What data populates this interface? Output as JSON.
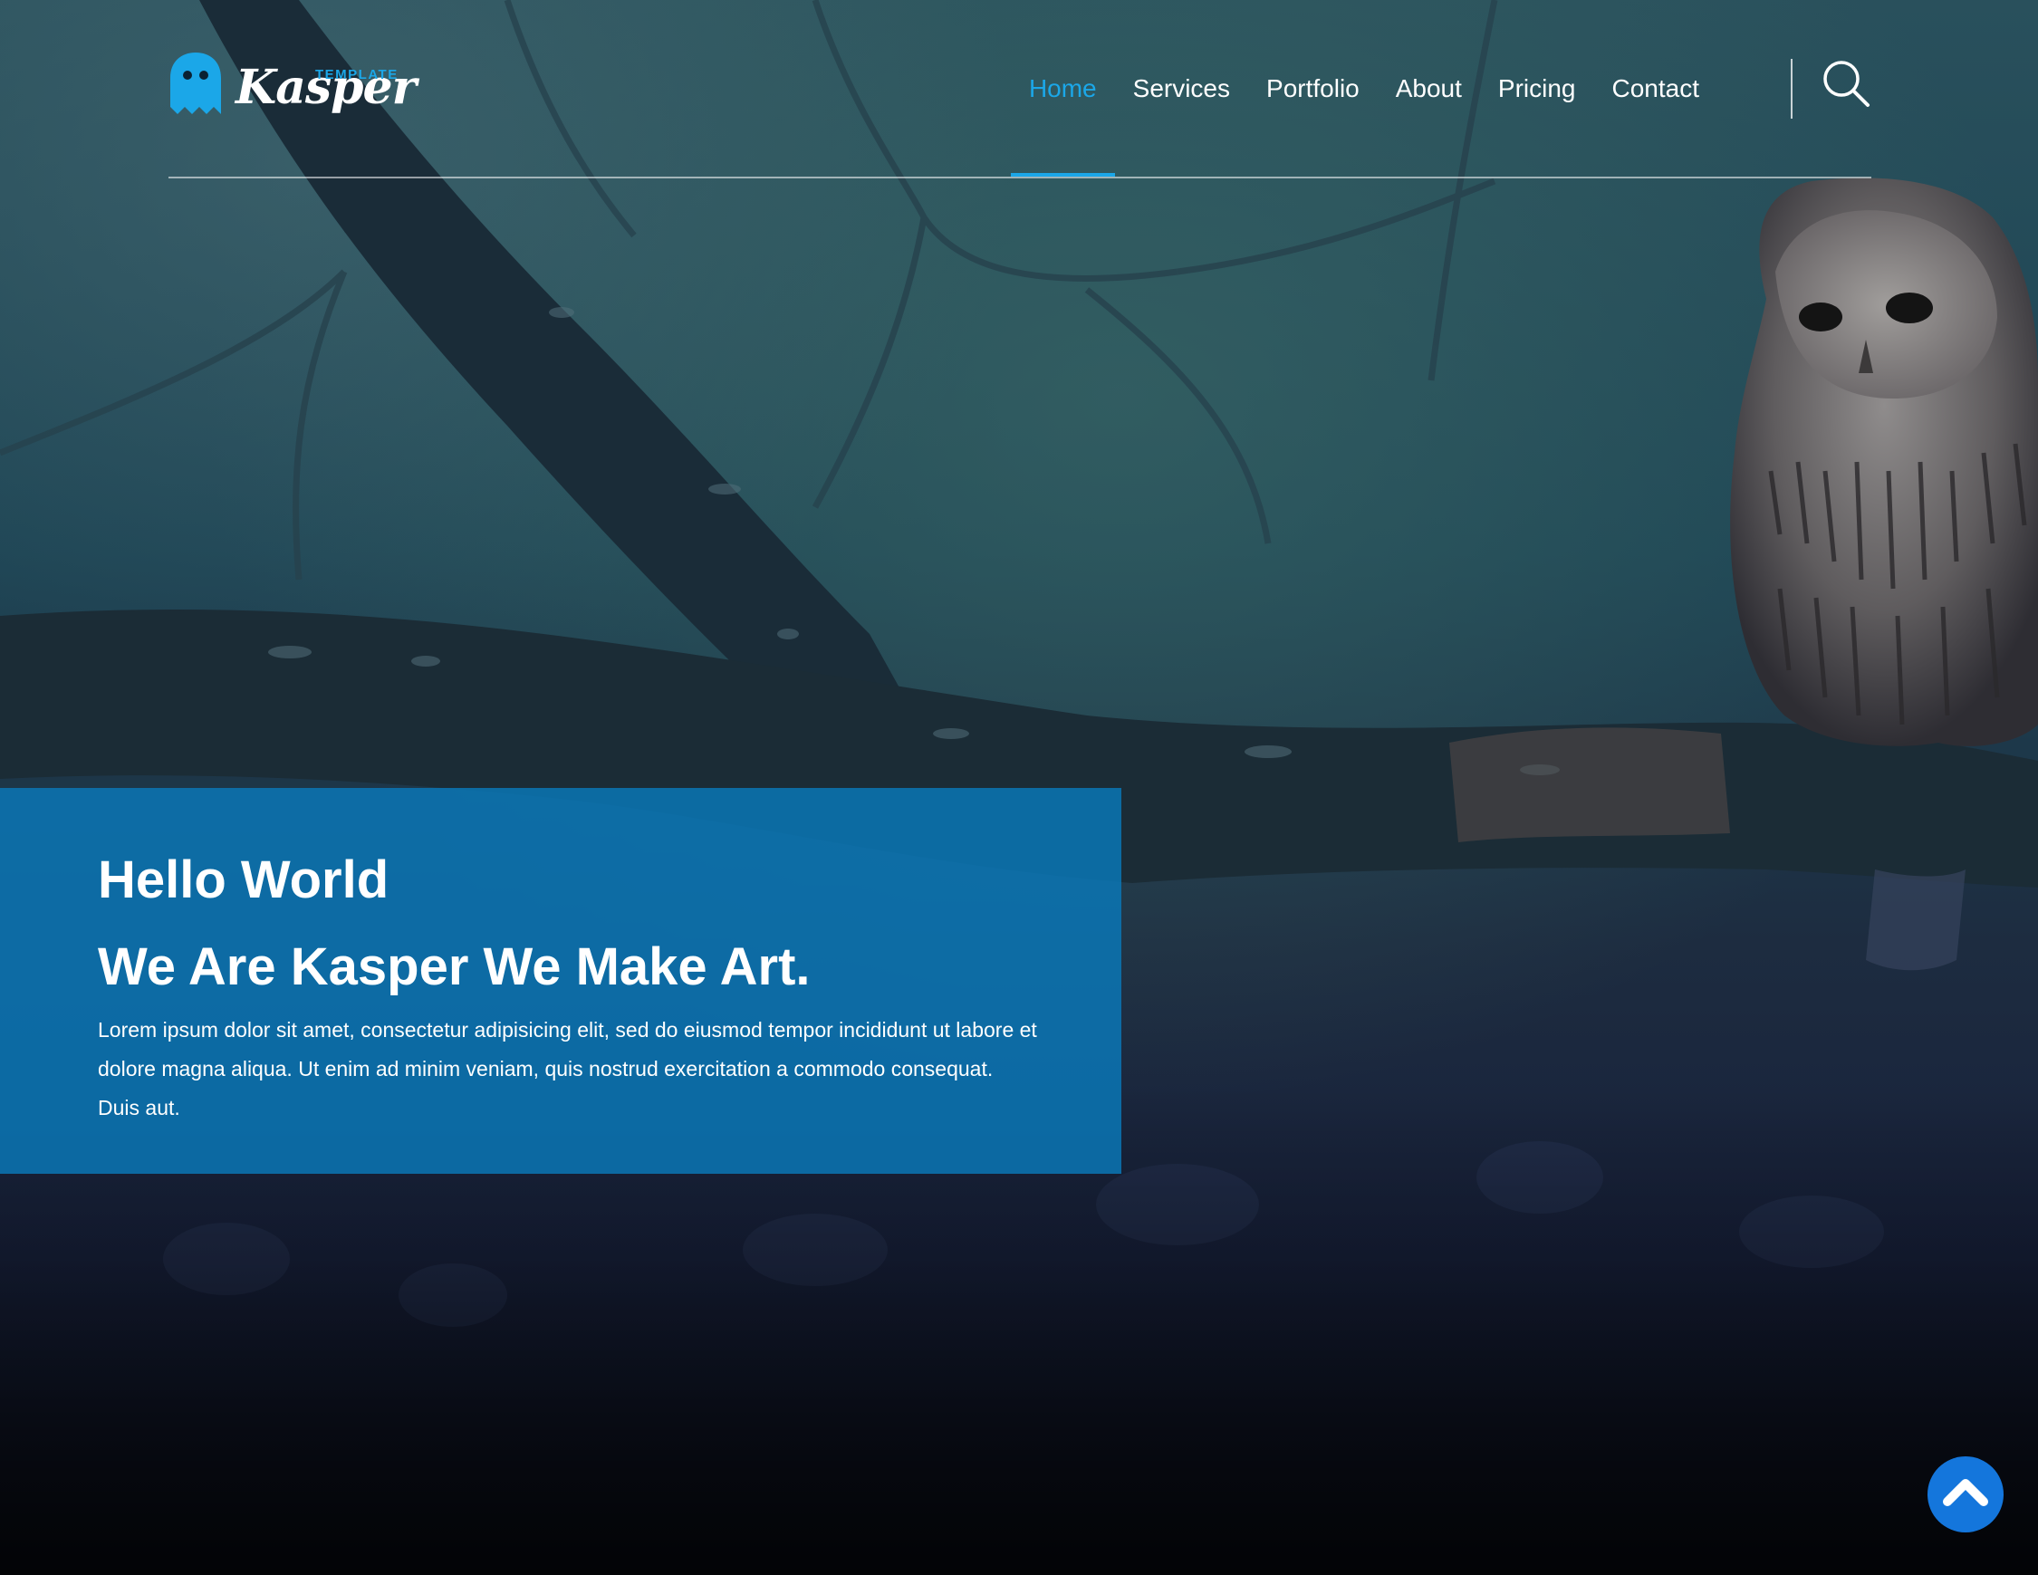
{
  "brand": {
    "name": "Kasper",
    "tag": "TEMPLATE",
    "accent_color": "#1ba7e8",
    "logo_icon": "ghost-icon"
  },
  "nav": {
    "items": [
      {
        "label": "Home",
        "active": true
      },
      {
        "label": "Services",
        "active": false
      },
      {
        "label": "Portfolio",
        "active": false
      },
      {
        "label": "About",
        "active": false
      },
      {
        "label": "Pricing",
        "active": false
      },
      {
        "label": "Contact",
        "active": false
      }
    ],
    "search_icon": "search-icon"
  },
  "hero": {
    "greeting": "Hello World",
    "title": "We Are Kasper We Make Art.",
    "text": "Lorem ipsum dolor sit amet, consectetur adipisicing elit, sed do eiusmod tempor incididunt ut labore et dolore magna aliqua. Ut enim ad minim veniam, quis nostrud exercitation a commodo consequat. Duis aut.",
    "box_color": "#0a76b5"
  },
  "scroll_top": {
    "icon": "chevron-up-icon",
    "color": "#1476dc"
  }
}
